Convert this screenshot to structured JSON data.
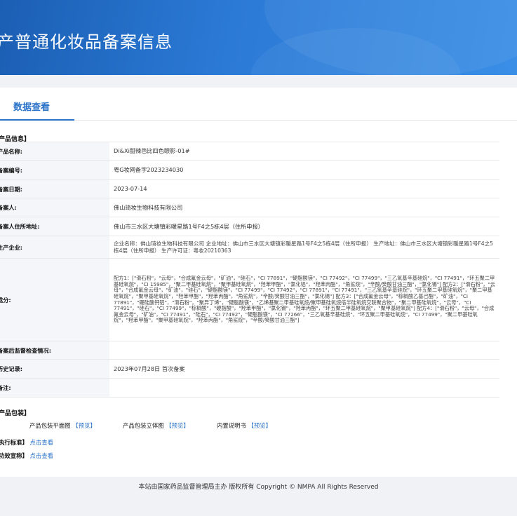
{
  "header": {
    "title": "产普通化妆品备案信息"
  },
  "tabs": [
    {
      "label": "数据查看"
    }
  ],
  "product_section": {
    "title": "产品信息】"
  },
  "fields": [
    {
      "label": "产品名称:",
      "value": "Di&Xi甜辣芭比四色眼影-01#"
    },
    {
      "label": "备案编号:",
      "value": "粤G妆网备字2023234030"
    },
    {
      "label": "备案日期:",
      "value": "2023-07-14"
    },
    {
      "label": "备案人:",
      "value": "佛山琦妆生物科技有限公司"
    },
    {
      "label": "备案人住所地址:",
      "value": "佛山市三水区大塘镇彩暖星路1号F4之5栋4层（住所申报）"
    },
    {
      "label": "生产企业:",
      "value": "企业名称：佛山琦妆生物科技有限公司 企业地址：佛山市三水区大塘镇彩暖星路1号F4之5栋4层（住所申报） 生产地址：佛山市三水区大塘镇彩暖星路1号F4之5栋4层（住所申报） 生产许可证：粤妆20210363"
    },
    {
      "label": "成分:",
      "value": "配方1：[\"滑石粉\"，\"云母\"，\"合成氟金云母\"，\"矿油\"，\"硅石\"，\"CI 77891\"，\"硬脂酸镁\"，\"CI 77492\"，\"CI 77499\"，\"三乙氧基辛基硅烷\"，\"CI 77491\"，\"环五聚二甲基硅氧烷\"，\"CI 15985\"，\"聚二甲基硅氧烷\"，\"聚甲基硅氧烷\"，\"羟苯甲酯\"，\"氯化铝\"，\"羟苯丙酯\"，\"角鲨烷\"，\"辛酸/癸酸甘油三酯\"，\"氯化锡\"] 配方2：[\"滑石粉\"，\"云母\"，\"合成氟金云母\"，\"矿油\"，\"硅石\"，\"硬脂酸镁\"，\"CI 77499\"，\"CI 77492\"，\"CI 77891\"，\"CI 77491\"，\"三乙氧基辛基硅烷\"，\"环五聚二甲基硅氧烷\"，\"聚二甲基硅氧烷\"，\"聚甲基硅氧烷\"，\"羟苯甲酯\"，\"羟苯丙酯\"，\"角鲨烷\"，\"辛酸/癸酸甘油三酯\"，\"氯化锡\"] 配方3：[\"合成氟金云母\"，\"棕榈酸乙基己酯\"，\"矿油\"，\"CI 77891\"，\"硼硅酸钙铝\"，\"滑石粉\"，\"聚异丁烯\"，\"硬脂酸镁\"，\"乙烯基聚二甲基硅氧烷/聚甲基硅氧烷倍半硅氧烷交联聚合物\"，\"聚二甲基硅氧烷\"，\"云母\"，\"CI 77491\"，\"硅石\"，\"CI 77499\"，\"棕榈酸\"，\"硬脂酸\"，\"羟苯甲酯\"，\"氯化锡\"，\"羟苯丙酯\"，\"环五聚二甲基硅氧烷\"，\"聚甲基硅氧烷\"] 配方4：[\"滑石粉\"，\"云母\"，\"合成氟金云母\"，\"矿油\"，\"CI 77491\"，\"硅石\"，\"CI 77492\"，\"硬脂酸镁\"，\"CI 77266\"，\"三乙氧基辛基硅烷\"，\"环五聚二甲基硅氧烷\"，\"CI 77499\"，\"聚二甲基硅氧烷\"，\"羟苯甲酯\"，\"聚甲基硅氧烷\"，\"羟苯丙酯\"，\"角鲨烷\"，\"辛酸/癸酸甘油三酯\"]"
    },
    {
      "label": "备案后监督检查情况:",
      "value": ""
    },
    {
      "label": "历史记录:",
      "value": "2023年07月28日 首次备案"
    },
    {
      "label": "备注:",
      "value": ""
    }
  ],
  "packaging": {
    "title": "产品包装】",
    "items": [
      {
        "label": "产品包装平面图",
        "link": "【预览】"
      },
      {
        "label": "产品包装立体图",
        "link": "【预览】"
      },
      {
        "label": "内置说明书",
        "link": "【预览】"
      }
    ]
  },
  "standards": {
    "label": "执行标准】",
    "link": "点击查看"
  },
  "efficacy": {
    "label": "功效宣称】",
    "link": "点击查看"
  },
  "footer": {
    "text": "本站由国家药品监督管理局主办 版权所有 Copyright © NMPA All Rights Reserved"
  }
}
